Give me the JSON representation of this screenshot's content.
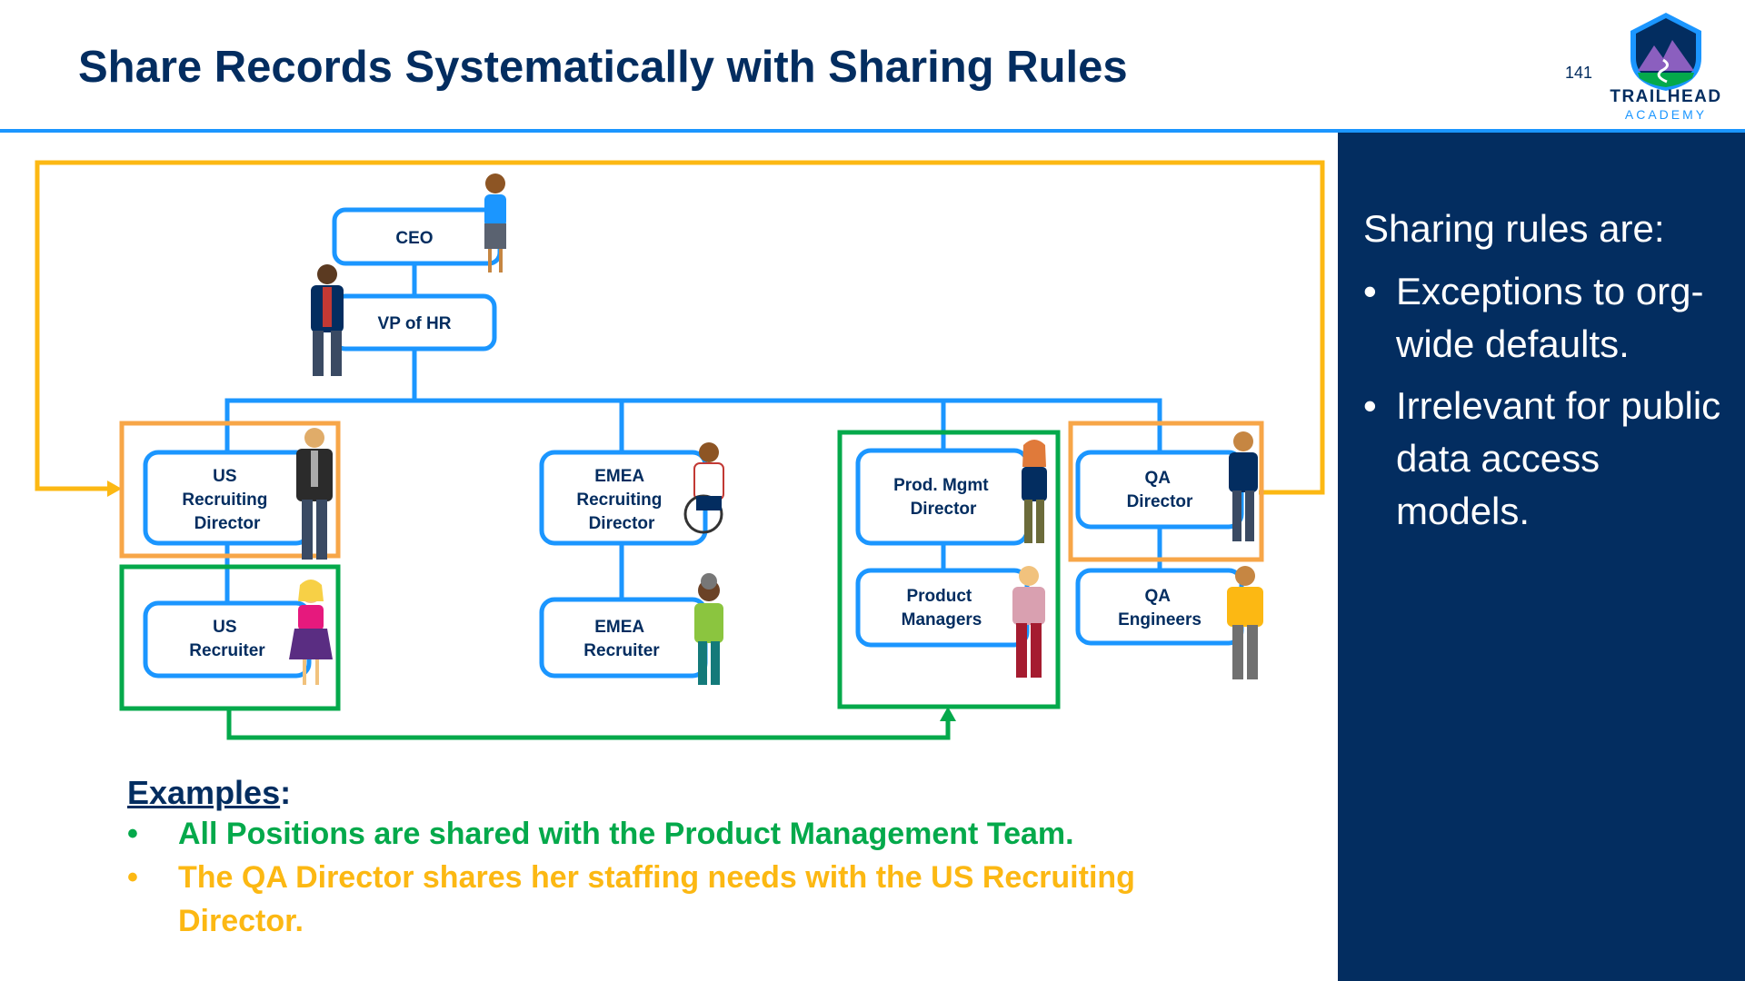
{
  "header": {
    "title": "Share Records Systematically with Sharing Rules",
    "slide_number": "141",
    "logo_line1": "TRAILHEAD",
    "logo_line2": "ACADEMY"
  },
  "side_panel": {
    "heading": "Sharing rules are:",
    "bullets": [
      "Exceptions to org-wide defaults.",
      "Irrelevant for public data access models."
    ]
  },
  "org_chart": {
    "nodes": {
      "ceo": [
        "CEO"
      ],
      "vp_hr": [
        "VP of HR"
      ],
      "us_recruiting_director": [
        "US",
        "Recruiting",
        "Director"
      ],
      "us_recruiter": [
        "US",
        "Recruiter"
      ],
      "emea_recruiting_director": [
        "EMEA",
        "Recruiting",
        "Director"
      ],
      "emea_recruiter": [
        "EMEA",
        "Recruiter"
      ],
      "prod_mgmt_director": [
        "Prod. Mgmt",
        "Director"
      ],
      "product_managers": [
        "Product",
        "Managers"
      ],
      "qa_director": [
        "QA",
        "Director"
      ],
      "qa_engineers": [
        "QA",
        "Engineers"
      ]
    }
  },
  "examples": {
    "heading": "Examples",
    "heading_suffix": ":",
    "bullet_symbol": "•",
    "items": [
      "All Positions are shared with the Product Management Team.",
      "The QA Director shares her staffing needs with the US Recruiting Director."
    ]
  },
  "colors": {
    "navy": "#032d60",
    "blue": "#1b96ff",
    "green": "#04a94b",
    "yellow": "#fcb813",
    "orange": "#f7a648"
  }
}
